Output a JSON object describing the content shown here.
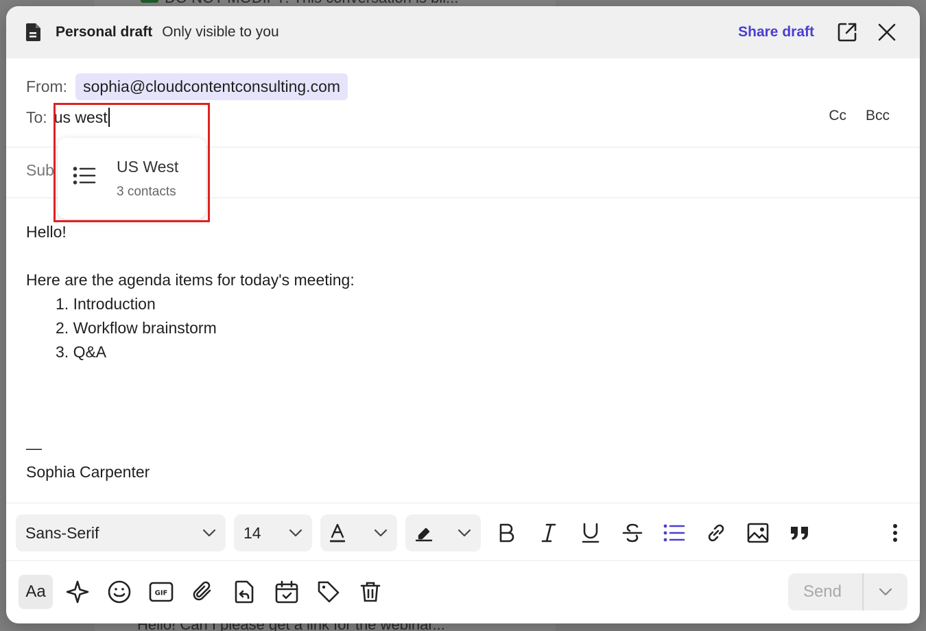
{
  "background": {
    "top_text": "DO NOT MODIFY: This conversation is bil...",
    "bottom_text": "Hello! Can I please get a link for the webinar..."
  },
  "header": {
    "title": "Personal draft",
    "subtitle": "Only visible to you",
    "share_label": "Share draft"
  },
  "from": {
    "label": "From:",
    "value": "sophia@cloudcontentconsulting.com"
  },
  "to": {
    "label": "To:",
    "value": "us west"
  },
  "cc_label": "Cc",
  "bcc_label": "Bcc",
  "subject": {
    "label_partial": "Sub"
  },
  "suggestion": {
    "title": "US West",
    "subtitle": "3 contacts"
  },
  "body": {
    "greeting": "Hello!",
    "intro": "Here are the agenda items for today's meeting:",
    "items": [
      "1. Introduction",
      "2. Workflow brainstorm",
      "3. Q&A"
    ],
    "sig_dash": "—",
    "signature": "Sophia Carpenter"
  },
  "toolbar": {
    "font_family": "Sans-Serif",
    "font_size": "14"
  },
  "bottom": {
    "aa_label": "Aa",
    "send_label": "Send"
  },
  "colors": {
    "accent": "#4b3fd1",
    "chip_bg": "#e6e4fb",
    "highlight": "#e02020"
  }
}
